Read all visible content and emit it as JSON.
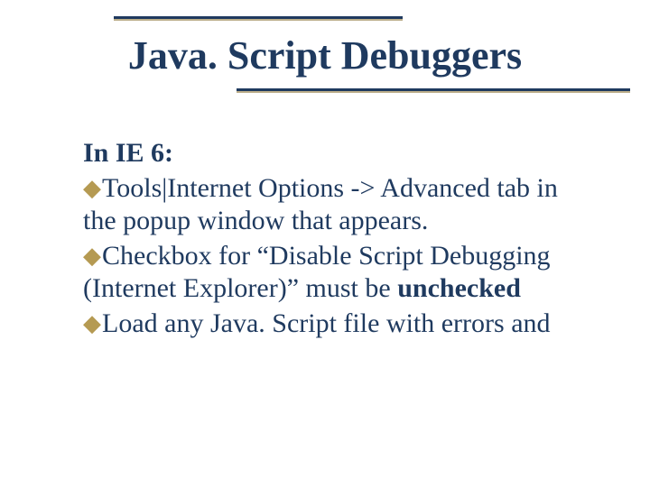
{
  "slide": {
    "title": "Java. Script Debuggers",
    "heading": "In IE 6:",
    "bullet_glyph": "◆",
    "items": [
      {
        "pre": "Tools|Internet Options -> Advanced tab in the popup window that appears."
      },
      {
        "pre": "Checkbox for “Disable Script Debugging (Internet Explorer)” must be ",
        "strong": "unchecked"
      },
      {
        "pre": "Load any Java. Script file with errors and"
      }
    ]
  }
}
